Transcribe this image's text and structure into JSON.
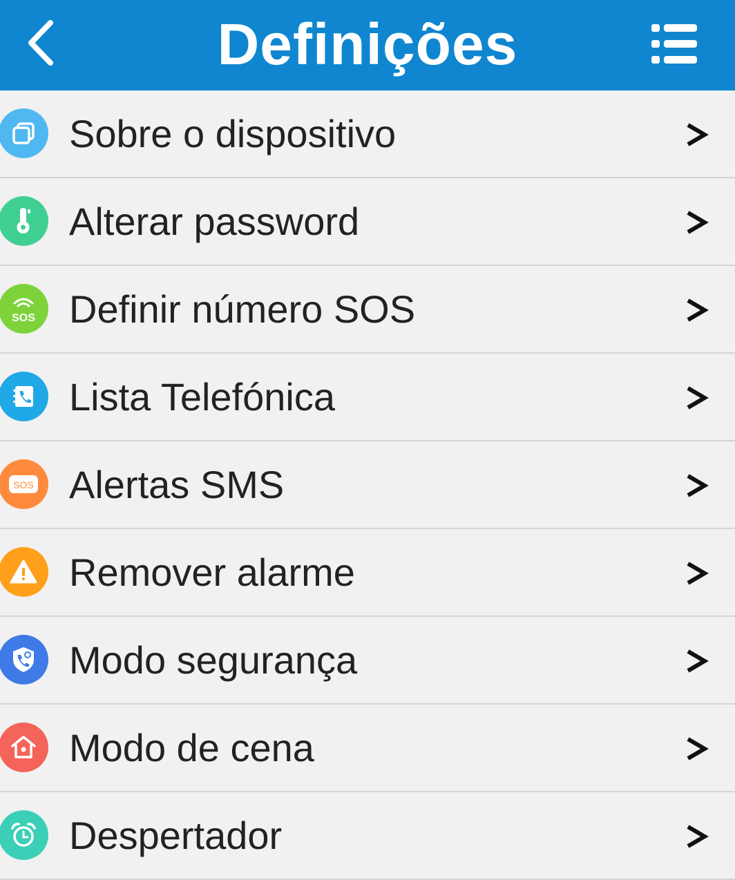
{
  "header": {
    "title": "Definições",
    "back_icon": "chevron-left-icon",
    "menu_icon": "list-menu-icon",
    "background_color": "#0f86cf"
  },
  "items": [
    {
      "label": "Sobre o dispositivo",
      "icon": "device-icon",
      "color": "#4fb8f1"
    },
    {
      "label": "Alterar password",
      "icon": "key-icon",
      "color": "#3fcf92"
    },
    {
      "label": "Definir número SOS",
      "icon": "sos-signal-icon",
      "color": "#7ed23a",
      "icon_text": "SOS"
    },
    {
      "label": "Lista Telefónica",
      "icon": "phonebook-icon",
      "color": "#21a8e6"
    },
    {
      "label": "Alertas SMS",
      "icon": "sos-message-icon",
      "color": "#ff8a3d",
      "icon_text": "SOS"
    },
    {
      "label": "Remover alarme",
      "icon": "warning-icon",
      "color": "#ff9f1a"
    },
    {
      "label": "Modo segurança",
      "icon": "shield-phone-icon",
      "color": "#3f7be6"
    },
    {
      "label": "Modo de cena",
      "icon": "home-icon",
      "color": "#f4645a"
    },
    {
      "label": "Despertador",
      "icon": "alarm-clock-icon",
      "color": "#3ccfb8"
    }
  ],
  "chevron_symbol": ">"
}
